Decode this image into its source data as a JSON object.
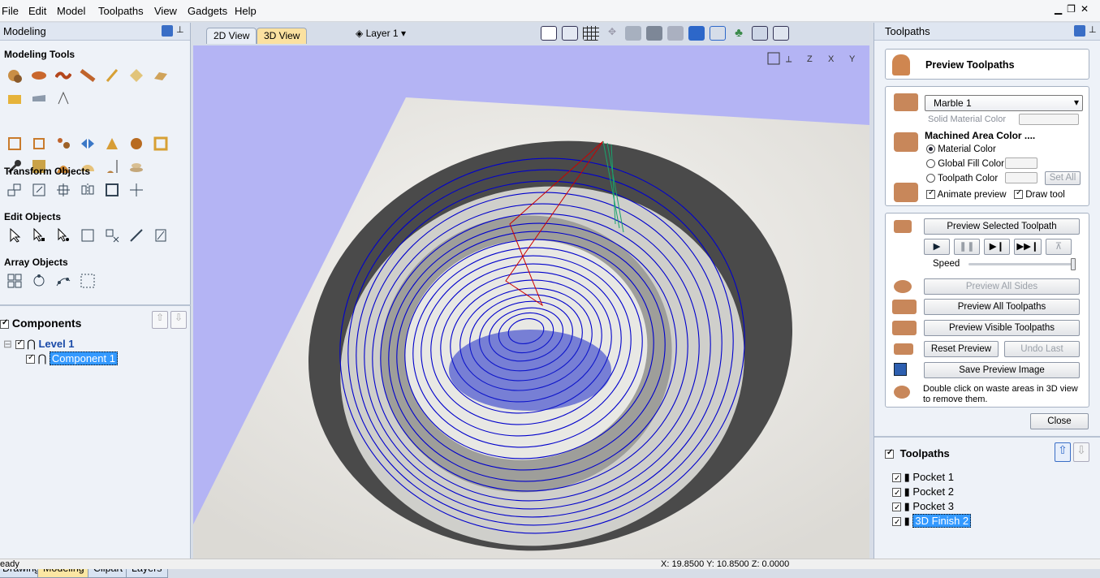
{
  "menu": [
    "File",
    "Edit",
    "Model",
    "Toolpaths",
    "View",
    "Gadgets",
    "Help"
  ],
  "left_panel": {
    "title": "Modeling",
    "sections": {
      "modeling_tools": "Modeling Tools",
      "transform_objects": "Transform Objects",
      "edit_objects": "Edit Objects",
      "array_objects": "Array Objects"
    },
    "components": {
      "header": "Components",
      "level": "Level 1",
      "component": "Component 1"
    },
    "tabs": [
      "Drawing",
      "Modeling",
      "Clipart",
      "Layers"
    ]
  },
  "view_tabs": {
    "tab_2d": "2D View",
    "tab_3d": "3D View",
    "layer": "Layer 1"
  },
  "right_panel": {
    "title": "Toolpaths",
    "preview_title": "Preview Toolpaths",
    "material": "Marble 1",
    "solid_material_color": "Solid Material Color",
    "machined_area_color": "Machined Area Color ....",
    "material_color": "Material Color",
    "global_fill_color": "Global Fill Color",
    "toolpath_color": "Toolpath Color",
    "set_all": "Set All",
    "animate_preview": "Animate preview",
    "draw_tool": "Draw tool",
    "preview_selected": "Preview Selected Toolpath",
    "speed": "Speed",
    "speed_level": 1.0,
    "preview_all_sides": "Preview All Sides",
    "preview_all_toolpaths": "Preview All Toolpaths",
    "preview_visible_toolpaths": "Preview Visible Toolpaths",
    "reset_preview": "Reset Preview",
    "undo_last": "Undo Last",
    "save_preview_image": "Save Preview Image",
    "hint": "Double click on waste areas in 3D view to remove them.",
    "close": "Close",
    "toolpaths_header": "Toolpaths",
    "toolpaths": [
      "Pocket 1",
      "Pocket 2",
      "Pocket 3",
      "3D Finish 2"
    ]
  },
  "status": {
    "left": "eady",
    "coords": "X: 19.8500 Y: 10.8500 Z: 0.0000"
  },
  "colors": {
    "accent": "#3399ff",
    "selection": "#3399ff",
    "viewport_bg": "#b4b4f4",
    "toolpath": "#0000cc",
    "material": "#c8875a"
  }
}
